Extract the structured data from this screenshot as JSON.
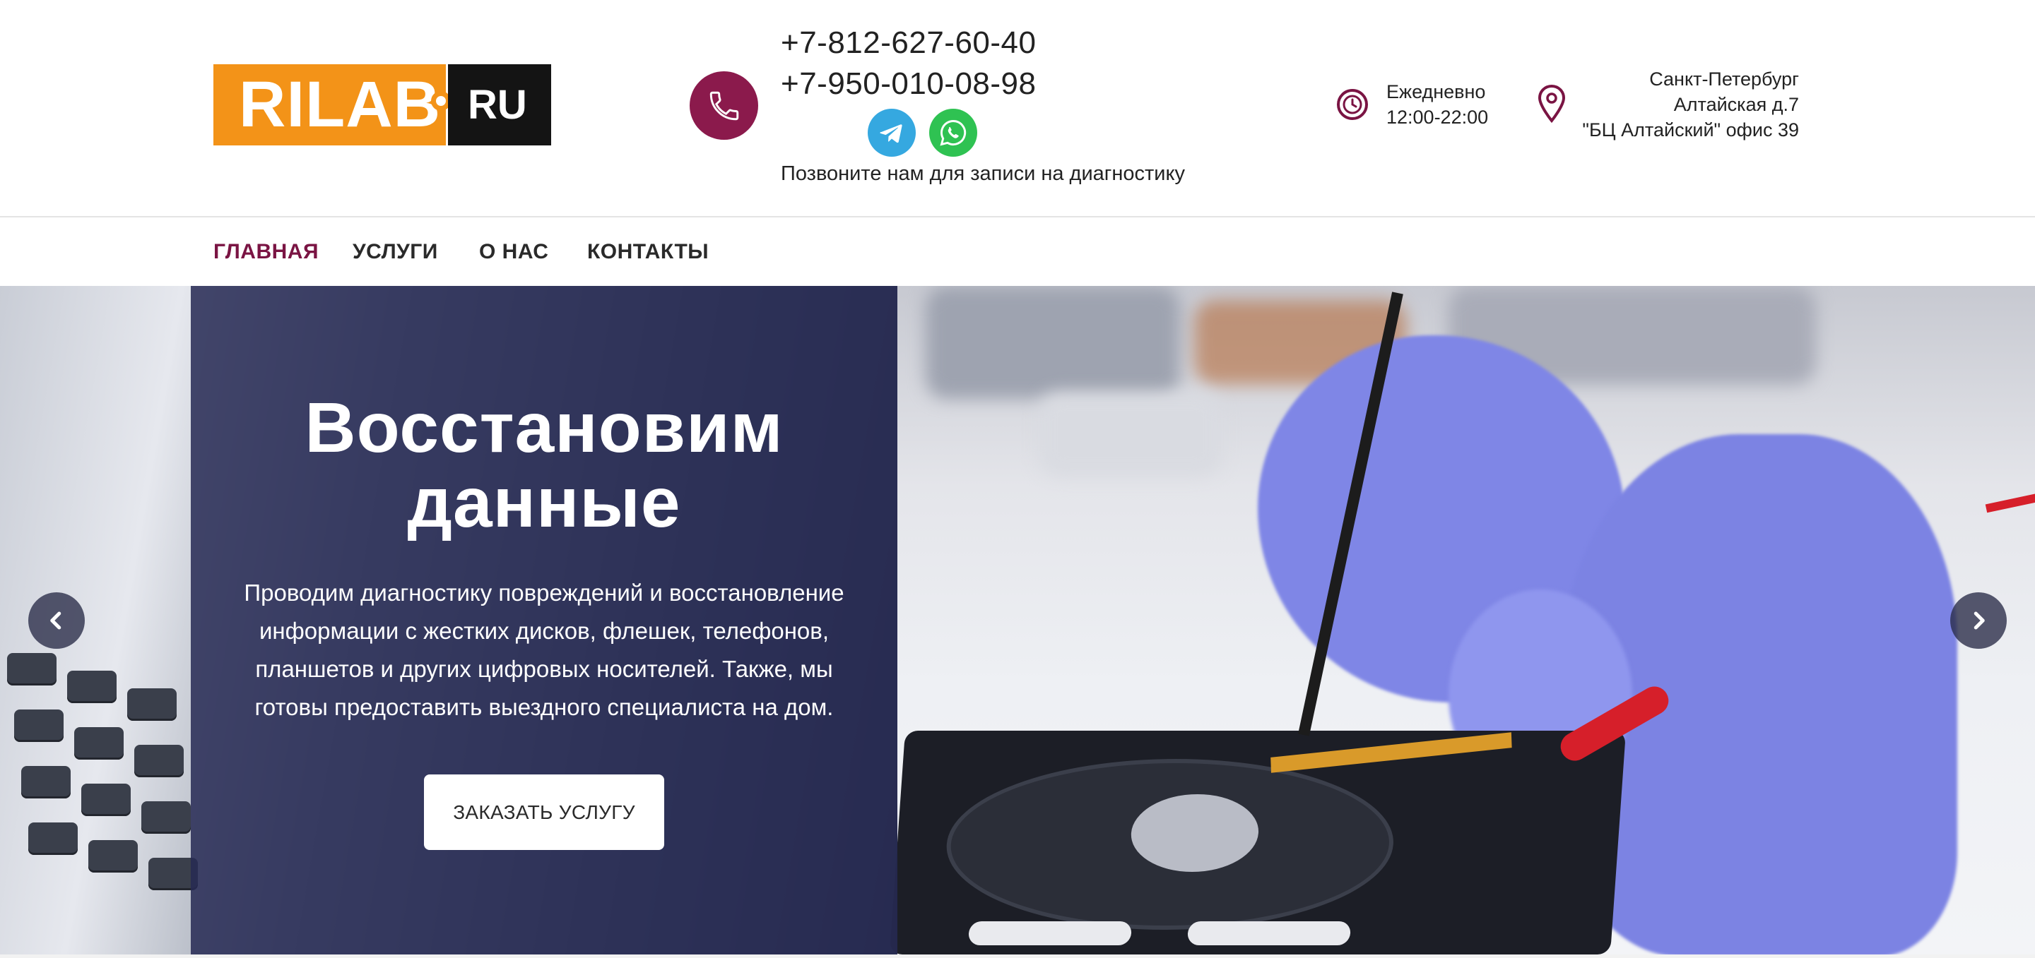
{
  "header": {
    "logo": {
      "word": "RILAB",
      "suffix": "RU"
    },
    "phones": [
      "+7-812-627-60-40",
      "+7-950-010-08-98"
    ],
    "messengers": [
      {
        "name": "Telegram",
        "icon": "telegram-icon",
        "color": "#35a8e0"
      },
      {
        "name": "WhatsApp",
        "icon": "whatsapp-icon",
        "color": "#2fc252"
      }
    ],
    "call_note": "Позвоните нам для записи на диагностику",
    "hours": {
      "line1": "Ежедневно",
      "line2": "12:00-22:00"
    },
    "address": {
      "line1": "Санкт-Петербург",
      "line2": "Алтайская д.7",
      "line3": "\"БЦ Алтайский\" офис 39"
    }
  },
  "nav": {
    "items": [
      {
        "label": "ГЛАВНАЯ",
        "active": true
      },
      {
        "label": "УСЛУГИ",
        "active": false
      },
      {
        "label": "О НАС",
        "active": false
      },
      {
        "label": "КОНТАКТЫ",
        "active": false
      }
    ]
  },
  "hero": {
    "title_line1": "Восстановим",
    "title_line2": "данные",
    "text": "Проводим диагностику повреждений и восстановление информации с жестких дисков, флешек, телефонов, планшетов и других цифровых носителей. Также, мы готовы предоставить выездного специалиста на дом.",
    "button": "ЗАКАЗАТЬ УСЛУГУ",
    "arrows": {
      "prev_icon": "chevron-left-icon",
      "next_icon": "chevron-right-icon"
    }
  },
  "colors": {
    "accent": "#7a1443",
    "phone_circle": "#8b1a4c",
    "logo_orange": "#f39318",
    "logo_dark": "#141414",
    "overlay": "#272a54"
  }
}
